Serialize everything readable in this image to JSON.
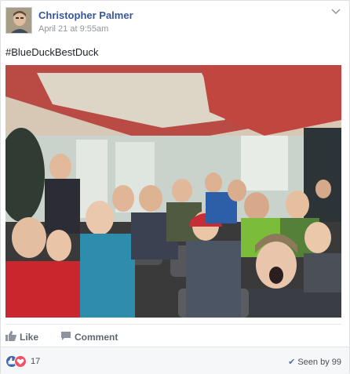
{
  "post": {
    "author": "Christopher Palmer",
    "timestamp": "April 21 at 9:55am",
    "text": "#BlueDuckBestDuck"
  },
  "actions": {
    "like": "Like",
    "comment": "Comment"
  },
  "footer": {
    "reaction_count": "17",
    "seen_by": "Seen by 99"
  },
  "icons": {
    "like": "thumbs-up-icon",
    "comment": "comment-bubble-icon",
    "reaction_like": "like-reaction-icon",
    "reaction_love": "love-reaction-icon",
    "seen": "checkmark-icon",
    "menu": "chevron-down-icon"
  },
  "colors": {
    "author_link": "#365899",
    "meta_text": "#90949c",
    "like_blue": "#4267b2",
    "love_red": "#f25268"
  }
}
